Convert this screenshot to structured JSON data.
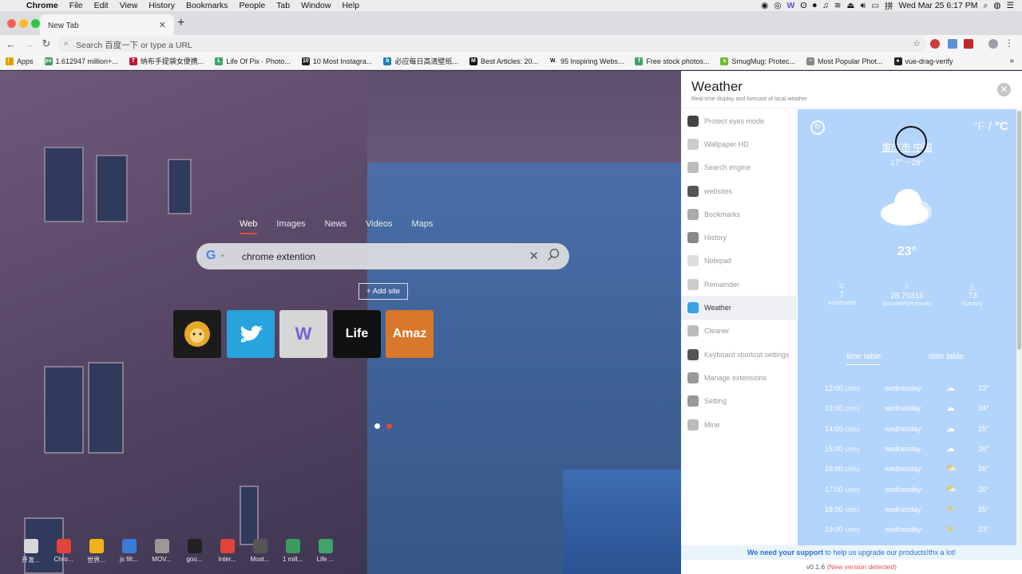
{
  "menubar": {
    "app": "Chrome",
    "items": [
      "File",
      "Edit",
      "View",
      "History",
      "Bookmarks",
      "People",
      "Tab",
      "Window",
      "Help"
    ],
    "datetime": "Wed Mar 25  6:17 PM"
  },
  "tab": {
    "title": "New Tab"
  },
  "omnibox": {
    "placeholder": "Search 百度一下 or type a URL"
  },
  "bookmarks": [
    {
      "label": "Apps",
      "color": "#e0a000",
      "glyph": "⋮⋮"
    },
    {
      "label": "1.612947 million+...",
      "color": "#3c9a5f",
      "glyph": "px"
    },
    {
      "label": "纳布手提袋女便携...",
      "color": "#c0152f",
      "glyph": "T"
    },
    {
      "label": "Life Of Pix · Photo...",
      "color": "#3fa36b",
      "glyph": "L"
    },
    {
      "label": "10 Most Instagra...",
      "color": "#222222",
      "glyph": "10"
    },
    {
      "label": "必应每日高清壁纸...",
      "color": "#1b7fb0",
      "glyph": "b"
    },
    {
      "label": "Best Articles: 20...",
      "color": "#111111",
      "glyph": "M"
    },
    {
      "label": "95 Inspiring Webs...",
      "color": "#ffffff",
      "glyph": "W."
    },
    {
      "label": "Free stock photos...",
      "color": "#3fa36b",
      "glyph": "f"
    },
    {
      "label": "SmugMug: Protec...",
      "color": "#6cbf2a",
      "glyph": "s"
    },
    {
      "label": "Most Popular Phot...",
      "color": "#888888",
      "glyph": "~"
    },
    {
      "label": "vue-drag-verify",
      "color": "#222222",
      "glyph": "●"
    }
  ],
  "search": {
    "tabs": [
      "Web",
      "Images",
      "News",
      "Videos",
      "Maps"
    ],
    "query": "chrome extention",
    "add_site": "+ Add site"
  },
  "sites": [
    {
      "label": "",
      "color": "#1b1b1b"
    },
    {
      "label": "",
      "color": "#27a3dd"
    },
    {
      "label": "",
      "color": "#d6d6d6"
    },
    {
      "label": "Life",
      "color": "#111111"
    },
    {
      "label": "Amaz",
      "color": "#d9772a"
    }
  ],
  "dock": [
    {
      "label": "开发...",
      "color": "#d8d8d8"
    },
    {
      "label": "Chro...",
      "color": "#e0443a"
    },
    {
      "label": "世界...",
      "color": "#f2b21b"
    },
    {
      "label": "js filt...",
      "color": "#3a7bd5"
    },
    {
      "label": "MOV...",
      "color": "#9a9a9a"
    },
    {
      "label": "goo...",
      "color": "#222222"
    },
    {
      "label": "Inter...",
      "color": "#e0443a"
    },
    {
      "label": "Most...",
      "color": "#555555"
    },
    {
      "label": "1 mill...",
      "color": "#3c9a5f"
    },
    {
      "label": "Life ...",
      "color": "#3fa36b"
    }
  ],
  "panel": {
    "title": "Weather",
    "subtitle": "Real-time display and forecast of local weather",
    "menu": [
      {
        "label": "Protect eyes mode",
        "color": "#444444"
      },
      {
        "label": "Wallpaper HD",
        "color": "#cccccc"
      },
      {
        "label": "Search engine",
        "color": "#bbbbbb"
      },
      {
        "label": "websites",
        "color": "#555555"
      },
      {
        "label": "Bookmarks",
        "color": "#aaaaaa"
      },
      {
        "label": "History",
        "color": "#888888"
      },
      {
        "label": "Notepad",
        "color": "#dddddd"
      },
      {
        "label": "Remainder",
        "color": "#cccccc"
      },
      {
        "label": "Weather",
        "color": "#3aa3e8"
      },
      {
        "label": "Cleaner",
        "color": "#bbbbbb"
      },
      {
        "label": "Keyboard shortcut settings",
        "color": "#555555"
      },
      {
        "label": "Manage extensions",
        "color": "#999999"
      },
      {
        "label": "Setting",
        "color": "#999999"
      },
      {
        "label": "Mine",
        "color": "#bbbbbb"
      }
    ],
    "active_item": "Weather"
  },
  "weather": {
    "units_f": "°F",
    "units_sep": "/",
    "units_c": "°C",
    "city": "重庆市 中国",
    "range": "17° ~ 28°",
    "temp": "23°",
    "stats": [
      {
        "value": "7",
        "label": "windSpeed"
      },
      {
        "value": "28.70316",
        "label": "barometricPressure"
      },
      {
        "value": "73",
        "label": "humidity"
      }
    ],
    "tabs": [
      "time table",
      "date table"
    ],
    "hourly": [
      {
        "time": "12:00",
        "day_note": "(25th)",
        "day": "wednesday",
        "icon": "cloud",
        "temp": "23°"
      },
      {
        "time": "13:00",
        "day_note": "(25th)",
        "day": "wednesday",
        "icon": "cloud",
        "temp": "24°"
      },
      {
        "time": "14:00",
        "day_note": "(25th)",
        "day": "wednesday",
        "icon": "cloud",
        "temp": "25°"
      },
      {
        "time": "15:00",
        "day_note": "(25th)",
        "day": "wednesday",
        "icon": "cloud",
        "temp": "26°"
      },
      {
        "time": "16:00",
        "day_note": "(25th)",
        "day": "wednesday",
        "icon": "partly-sunny",
        "temp": "26°"
      },
      {
        "time": "17:00",
        "day_note": "(25th)",
        "day": "wednesday",
        "icon": "partly-sunny",
        "temp": "26°"
      },
      {
        "time": "18:00",
        "day_note": "(25th)",
        "day": "wednesday",
        "icon": "sun",
        "temp": "25°"
      },
      {
        "time": "19:00",
        "day_note": "(25th)",
        "day": "wednesday",
        "icon": "sun",
        "temp": "23°"
      }
    ]
  },
  "footer": {
    "support_link": "We need your support",
    "support_rest": " to help us upgrade our products!thx a lot!",
    "version": "v0.1.6",
    "version_note": "(New version detected)"
  },
  "colors": {
    "accent_red": "#e24a3b",
    "weather_bg": "#b3d4fb",
    "link_blue": "#2b6fd1"
  }
}
